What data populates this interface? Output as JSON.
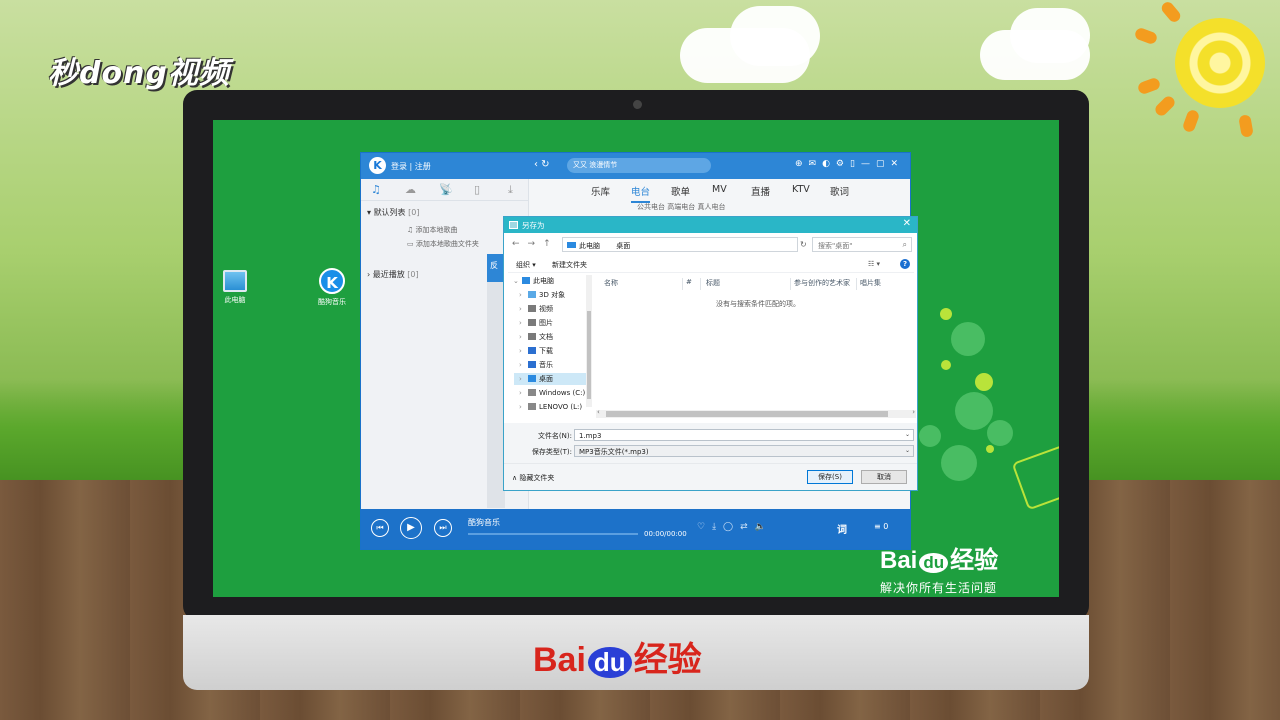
{
  "watermark_top": "秒dong视频",
  "baidu_logo": {
    "bai": "Bai",
    "du": "du",
    "jingyan": "经验"
  },
  "baidu_slogan": "解决你所有生活问题",
  "desktop": {
    "icons": [
      {
        "label": "此电脑",
        "icon": "computer-icon"
      },
      {
        "label": "酷狗音乐",
        "icon": "kugou-icon"
      }
    ]
  },
  "player": {
    "logo": "K",
    "login_text": "登录 | 注册",
    "search_placeholder": "又又 浪漫情节",
    "main_tabs": [
      "乐库",
      "电台",
      "歌单",
      "MV",
      "直播",
      "KTV",
      "歌词"
    ],
    "active_tab": "电台",
    "subtabs": "公共电台    高端电台    真人电台",
    "sidebar": {
      "default_list": "默认列表",
      "default_count": "[0]",
      "add_local": "添加本地歌曲",
      "add_folder": "添加本地歌曲文件夹",
      "recent": "最近播放",
      "recent_count": "[0]"
    },
    "blue_button_char": "反",
    "now_playing": "酷狗音乐",
    "time": "00:00/00:00",
    "lyric_button": "词",
    "queue_count": "0"
  },
  "dialog": {
    "title": "另存为",
    "breadcrumb": [
      "此电脑",
      "桌面"
    ],
    "search_placeholder": "搜索\"桌面\"",
    "toolbar": {
      "organize": "组织 ▾",
      "new_folder": "新建文件夹"
    },
    "tree": [
      {
        "label": "此电脑",
        "icon_color": "#2b8ae0",
        "expanded": true
      },
      {
        "label": "3D 对象",
        "icon_color": "#5aa9e6"
      },
      {
        "label": "视频",
        "icon_color": "#7a7a7a"
      },
      {
        "label": "图片",
        "icon_color": "#7a7a7a"
      },
      {
        "label": "文档",
        "icon_color": "#7a7a7a"
      },
      {
        "label": "下载",
        "icon_color": "#2b6fd0"
      },
      {
        "label": "音乐",
        "icon_color": "#2b6fd0"
      },
      {
        "label": "桌面",
        "icon_color": "#2b8ae0",
        "selected": true
      },
      {
        "label": "Windows (C:)",
        "icon_color": "#888888"
      },
      {
        "label": "LENOVO (L:)",
        "icon_color": "#888888"
      }
    ],
    "columns": [
      "名称",
      "#",
      "标题",
      "参与创作的艺术家",
      "唱片集"
    ],
    "empty_message": "没有与搜索条件匹配的项。",
    "filename_label": "文件名(N):",
    "filename_value": "1.mp3",
    "filetype_label": "保存类型(T):",
    "filetype_value": "MP3音乐文件(*.mp3)",
    "hide_folders": "隐藏文件夹",
    "save_button": "保存(S)",
    "cancel_button": "取消"
  }
}
